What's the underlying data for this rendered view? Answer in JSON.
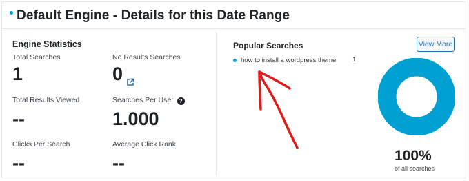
{
  "header": {
    "title": "Default Engine - Details for this Date Range"
  },
  "engine_stats": {
    "title": "Engine Statistics",
    "total_searches": {
      "label": "Total Searches",
      "value": "1"
    },
    "no_results_searches": {
      "label": "No Results Searches",
      "value": "0",
      "link_icon": "external-link-icon"
    },
    "total_results_viewed": {
      "label": "Total Results Viewed",
      "value": "--"
    },
    "searches_per_user": {
      "label": "Searches Per User",
      "value": "1.000",
      "help_icon": "question-icon",
      "help_glyph": "?"
    },
    "clicks_per_search": {
      "label": "Clicks Per Search",
      "value": "--"
    },
    "average_click_rank": {
      "label": "Average Click Rank",
      "value": "--"
    }
  },
  "popular_searches": {
    "title": "Popular Searches",
    "view_more_label": "View More",
    "items": [
      {
        "term": "how to install a wordpress theme",
        "count": "1"
      }
    ],
    "donut": {
      "fraction": 1.0,
      "color": "#00a0d2"
    },
    "percent": "100%",
    "percent_caption": "of all searches"
  },
  "colors": {
    "accent": "#00a0d2",
    "link": "#2271b1",
    "annotation_arrow": "#e01b1b"
  }
}
